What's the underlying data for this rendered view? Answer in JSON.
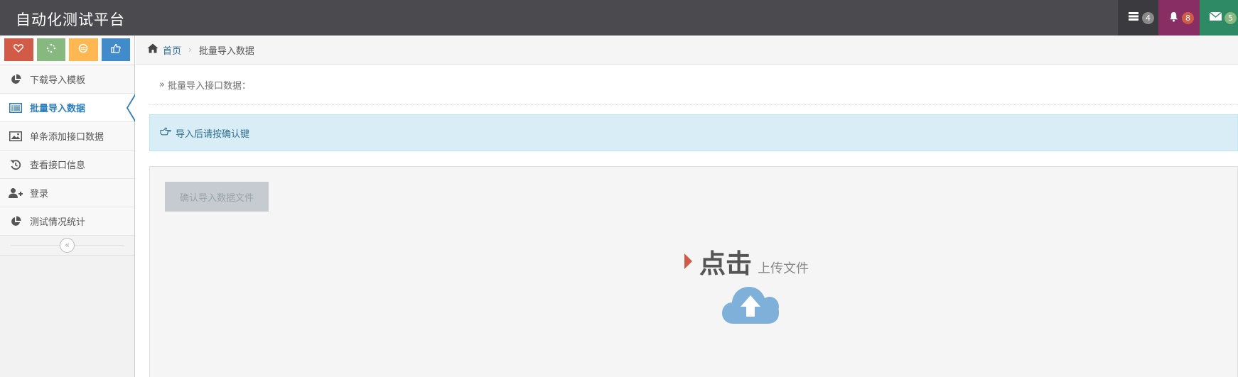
{
  "navbar": {
    "brand": "自动化测试平台",
    "tasks_icon": "tasks-icon",
    "tasks_count": "4",
    "notifications_icon": "bell-icon",
    "notifications_count": "8",
    "messages_icon": "envelope-icon",
    "messages_count": "5"
  },
  "sidebar": {
    "shortcuts": [
      {
        "icon": "heart-icon",
        "color": "#d15b47"
      },
      {
        "icon": "spinner-icon",
        "color": "#87b87f"
      },
      {
        "icon": "circle-icon",
        "color": "#ffb752"
      },
      {
        "icon": "thumbs-up-icon",
        "color": "#428bca"
      }
    ],
    "items": [
      {
        "label": "下载导入模板",
        "icon": "pie-chart-icon",
        "active": false
      },
      {
        "label": "批量导入数据",
        "icon": "list-alt-icon",
        "active": true
      },
      {
        "label": "单条添加接口数据",
        "icon": "picture-icon",
        "active": false
      },
      {
        "label": "查看接口信息",
        "icon": "history-icon",
        "active": false
      },
      {
        "label": "登录",
        "icon": "user-plus-icon",
        "active": false
      },
      {
        "label": "测试情况统计",
        "icon": "pie-chart-icon",
        "active": false
      }
    ],
    "collapse_icon": "double-angle-left-icon",
    "collapse_glyph": "«"
  },
  "breadcrumb": {
    "home": "首页",
    "separator": "›",
    "current": "批量导入数据"
  },
  "page_header": {
    "prefix": "»",
    "title": "批量导入接口数据："
  },
  "alert": {
    "icon": "hand-right-icon",
    "text": "导入后请按确认键"
  },
  "upload": {
    "confirm_button": "确认导入数据文件",
    "title_bold": "点击",
    "title_sub": "上传文件",
    "icon": "cloud-upload-icon",
    "cloud_color": "#7fb0da"
  }
}
